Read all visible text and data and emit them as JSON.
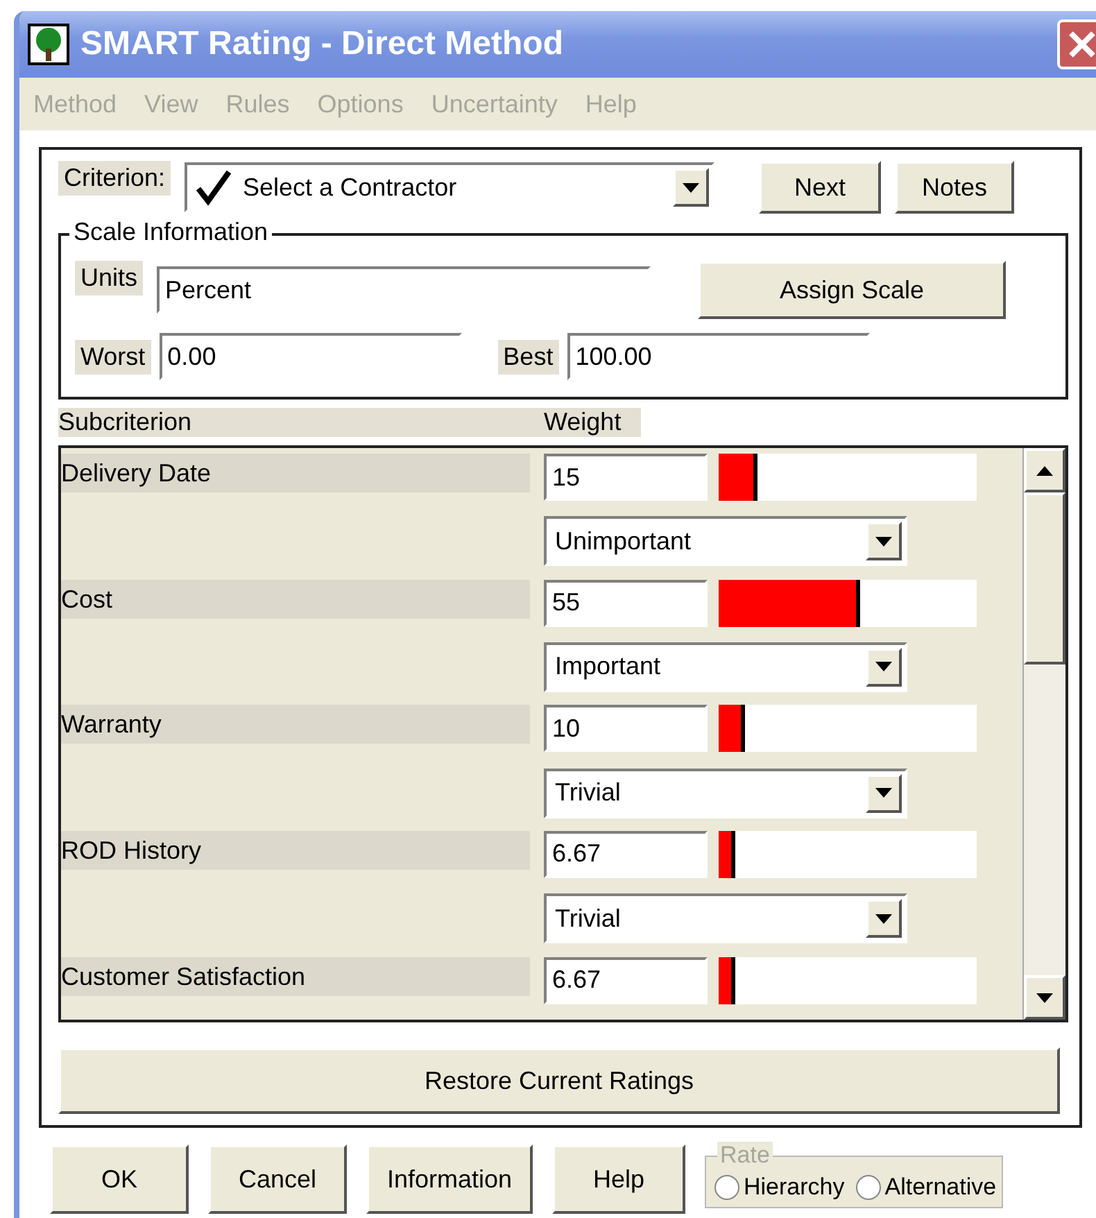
{
  "window": {
    "title": "SMART Rating - Direct Method"
  },
  "menu": [
    {
      "label": "Method",
      "disabled": true
    },
    {
      "label": "View",
      "disabled": true
    },
    {
      "label": "Rules",
      "disabled": true
    },
    {
      "label": "Options",
      "disabled": true
    },
    {
      "label": "Uncertainty",
      "disabled": true
    },
    {
      "label": "Help",
      "disabled": true
    }
  ],
  "criterion": {
    "label": "Criterion:",
    "value": "Select a Contractor",
    "checked": true
  },
  "top_buttons": [
    {
      "label": "Next"
    },
    {
      "label": "Notes"
    }
  ],
  "scale": {
    "title": "Scale Information",
    "units_label": "Units",
    "units": "Percent",
    "assign": {
      "label": "Assign Scale"
    },
    "worst_label": "Worst",
    "worst": "0.00",
    "best_label": "Best",
    "best": "100.00"
  },
  "columns": [
    "Subcriterion",
    "Weight"
  ],
  "rows": [
    {
      "name": "Delivery Date",
      "weight": "15",
      "level": 0.15,
      "importance": "Unimportant"
    },
    {
      "name": "Cost",
      "weight": "55",
      "level": 0.55,
      "importance": "Important"
    },
    {
      "name": "Warranty",
      "weight": "10",
      "level": 0.1,
      "importance": "Trivial"
    },
    {
      "name": "ROD History",
      "weight": "6.67",
      "level": 0.0667,
      "importance": "Trivial"
    },
    {
      "name": "Customer Satisfaction",
      "weight": "6.67",
      "level": 0.0667
    }
  ],
  "restore": {
    "label": "Restore Current Ratings"
  },
  "bottom_buttons": [
    {
      "label": "OK"
    },
    {
      "label": "Cancel"
    },
    {
      "label": "Information"
    },
    {
      "label": "Help"
    }
  ],
  "rate": {
    "title": "Rate",
    "options": [
      {
        "label": "Hierarchy",
        "selected": false
      },
      {
        "label": "Alternative",
        "selected": false
      }
    ]
  }
}
